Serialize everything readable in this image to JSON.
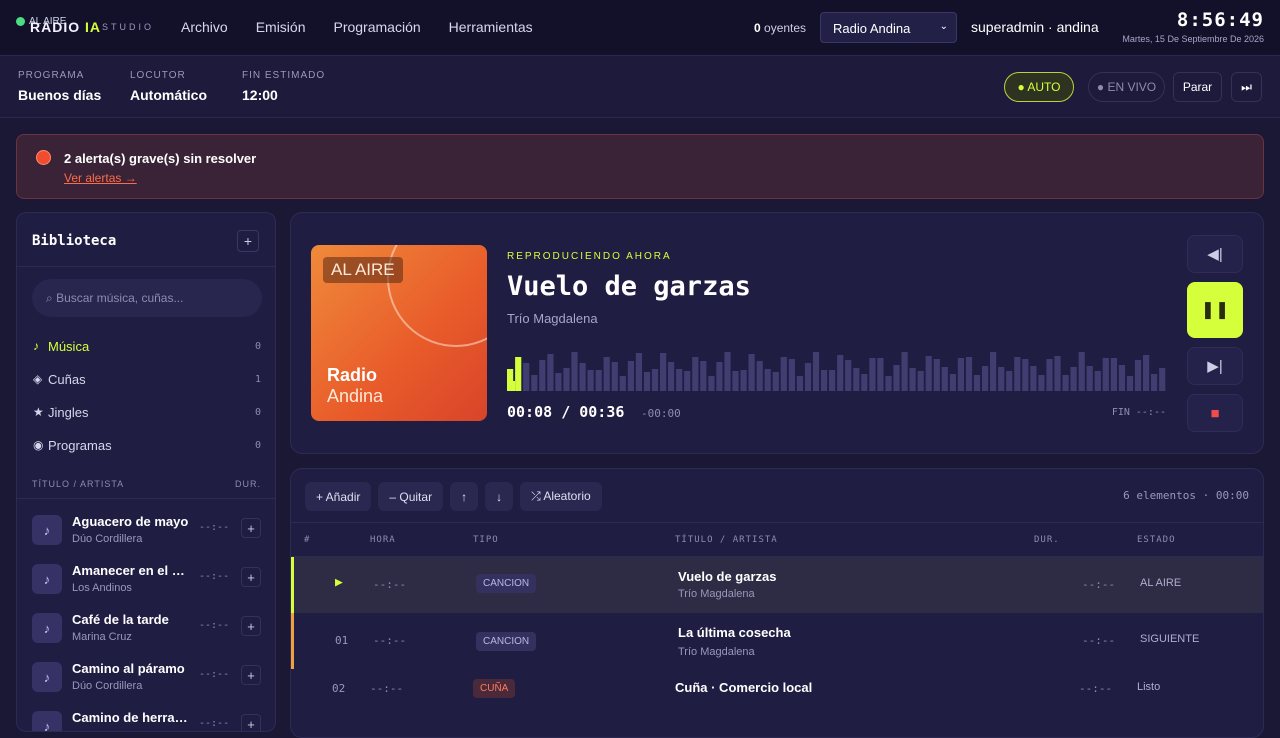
{
  "app": {
    "onair_label": "AL AIRE",
    "brand": "RADIO",
    "brand_accent": "IA",
    "studio": "STUDIO"
  },
  "nav": [
    "Archivo",
    "Emisión",
    "Programación",
    "Herramientas"
  ],
  "header": {
    "listeners_count": "0",
    "listeners_label": "oyentes",
    "station_select": "Radio Andina",
    "user": "superadmin · andina",
    "time": "8:56:49",
    "date": "Martes, 15 De Septiembre De 2026"
  },
  "program_bar": {
    "fields": [
      {
        "label": "PROGRAMA",
        "value": "Buenos días"
      },
      {
        "label": "LOCUTOR",
        "value": "Automático"
      },
      {
        "label": "FIN ESTIMADO",
        "value": "12:00"
      }
    ],
    "auto_label": "● AUTO",
    "live_label": "● EN VIVO",
    "stop_label": "Parar",
    "skip_icon": "⏭"
  },
  "alert": {
    "title": "2 alerta(s) grave(s) sin resolver",
    "link": "Ver alertas →"
  },
  "library": {
    "title": "Biblioteca",
    "add": "+",
    "search_placeholder": "Buscar música, cuñas...",
    "categories": [
      {
        "icon": "♪",
        "name": "Música",
        "count": "0"
      },
      {
        "icon": "◈",
        "name": "Cuñas",
        "count": "1"
      },
      {
        "icon": "★",
        "name": "Jingles",
        "count": "0"
      },
      {
        "icon": "◉",
        "name": "Programas",
        "count": "0"
      }
    ],
    "col_title": "TÍTULO / ARTISTA",
    "col_dur": "DUR.",
    "tracks": [
      {
        "title": "Aguacero de mayo",
        "artist": "Dúo Cordillera",
        "dur": "--:--"
      },
      {
        "title": "Amanecer en el valle",
        "artist": "Los Andinos",
        "dur": "--:--"
      },
      {
        "title": "Café de la tarde",
        "artist": "Marina Cruz",
        "dur": "--:--"
      },
      {
        "title": "Camino al páramo",
        "artist": "Dúo Cordillera",
        "dur": "--:--"
      },
      {
        "title": "Camino de herradura",
        "artist": "",
        "dur": "--:--"
      }
    ]
  },
  "player": {
    "cover_badge": "AL AIRE",
    "cover_line1": "Radio",
    "cover_line2": "Andina",
    "now_playing_label": "REPRODUCIENDO AHORA",
    "title": "Vuelo de garzas",
    "artist": "Trío Magdalena",
    "elapsed": "00:08",
    "sep": "/",
    "total": "00:36",
    "remaining": "-00:00",
    "end": "FIN --:--",
    "progress": 0.02
  },
  "queue": {
    "buttons": [
      "+ Añadir",
      "– Quitar",
      "↑",
      "↓",
      "⤮ Aleatorio"
    ],
    "count": "6 elementos · 00:00",
    "headers": [
      "#",
      "HORA",
      "TIPO",
      "TÍTULO / ARTISTA",
      "DUR.",
      "ESTADO"
    ],
    "rows": [
      {
        "num": "▶",
        "time": "--:--",
        "type": "CANCION",
        "title": "Vuelo de garzas",
        "artist": "Trío Magdalena",
        "dur": "--:--",
        "status": "AL AIRE"
      },
      {
        "num": "01",
        "time": "--:--",
        "type": "CANCION",
        "title": "La última cosecha",
        "artist": "Trío Magdalena",
        "dur": "--:--",
        "status": "SIGUIENTE"
      },
      {
        "num": "02",
        "time": "--:--",
        "type": "CUÑA",
        "title": "Cuña · Comercio local",
        "artist": "",
        "dur": "--:--",
        "status": "Listo"
      }
    ]
  },
  "colors": {
    "accent": "#d4ff3a",
    "alert": "#f04c2f",
    "bg": "#1b1836",
    "next": "#f0a040"
  }
}
